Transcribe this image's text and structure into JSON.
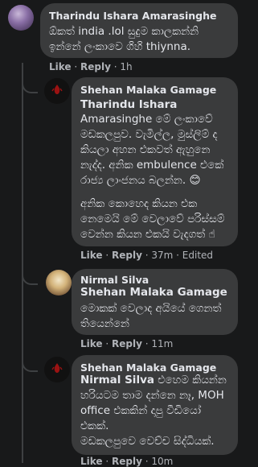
{
  "comments": [
    {
      "author": "Tharindu Ishara Amarasinghe",
      "lines": [
        "ඕකත් india .lol සුදුම කාලකන්නි",
        "ඉන්නේ ලංකාවෙ ගිහි thiynna."
      ],
      "actions": {
        "like": "Like",
        "reply": "Reply",
        "time": "1h"
      }
    },
    {
      "author": "Shehan Malaka Gamage",
      "mention": "Tharindu Ishara",
      "lines": [
        "Amarasinghe මේ ලංකාවේ",
        "මඩකලපුව. වැමිල්ල, මුස්ලිම් ද",
        "කියලා අහන එකවත් ඇහුනෙ",
        "නැද්ද. අනික embulence එකේ",
        "රාජ්‍ය ලාංජනය බලන්න. 😊"
      ],
      "lines2": [
        "අනික කොහෙද කියන එක",
        "නෙමෙයි මේ වෙලාවේ පරිස්සම්",
        "වෙන්න කියන එකයි වැදගත් ☝"
      ],
      "actions": {
        "like": "Like",
        "reply": "Reply",
        "time": "37m",
        "edited": "Edited"
      }
    },
    {
      "author": "Nirmal Silva",
      "mention": "Shehan Malaka Gamage",
      "lines": [
        "මොකක් වෙලාද අයියේ ගෙනත්",
        "තියෙන්නේ"
      ],
      "actions": {
        "like": "Like",
        "reply": "Reply",
        "time": "11m"
      }
    },
    {
      "author": "Shehan Malaka Gamage",
      "mention": "Nirmal Silva",
      "lines": [
        "එහෙම කියන්න",
        "හරියටම තාම දන්නෙ නෑ, MOH",
        "office එකකින් දාපු වීඩියෝ",
        "එකක්.",
        "මඩකලපුවෙ වෙච්ච සිද්ධියක්."
      ],
      "actions": {
        "like": "Like",
        "reply": "Reply",
        "time": "10m"
      }
    }
  ]
}
